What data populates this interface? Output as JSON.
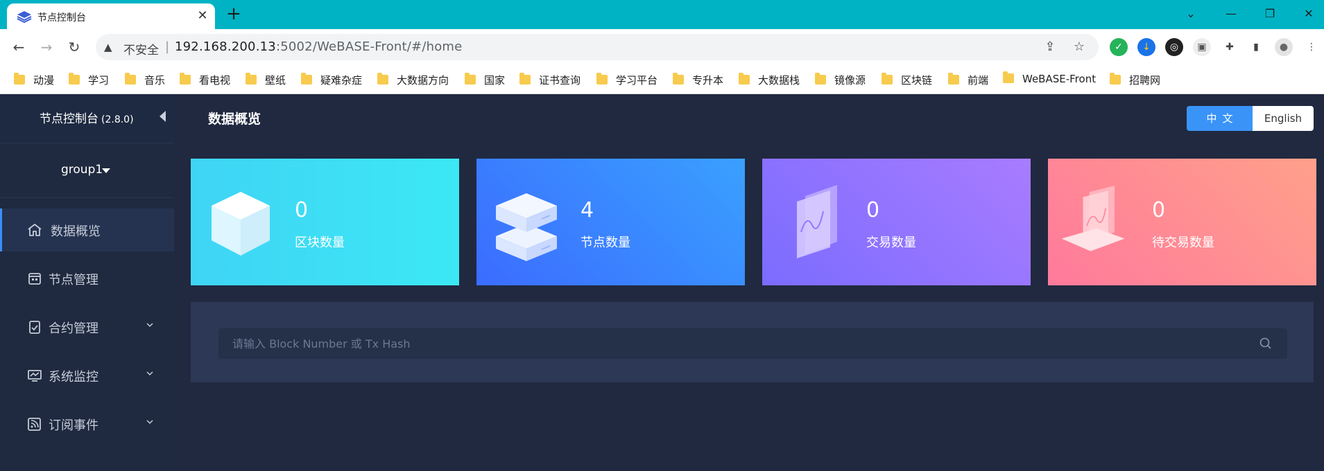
{
  "browser": {
    "tab_title": "节点控制台",
    "address": {
      "security_label": "不安全",
      "host": "192.168.200.13",
      "rest": ":5002/WeBASE-Front/#/home"
    },
    "bookmarks": [
      "动漫",
      "学习",
      "音乐",
      "看电视",
      "壁纸",
      "疑难杂症",
      "大数据方向",
      "国家",
      "证书查询",
      "学习平台",
      "专升本",
      "大数据栈",
      "镜像源",
      "区块链",
      "前端",
      "WeBASE-Front",
      "招聘网"
    ]
  },
  "sidebar": {
    "title": "节点控制台",
    "version": "(2.8.0)",
    "group": "group1",
    "items": [
      {
        "label": "数据概览",
        "active": true
      },
      {
        "label": "节点管理"
      },
      {
        "label": "合约管理"
      },
      {
        "label": "系统监控"
      },
      {
        "label": "订阅事件"
      }
    ]
  },
  "main": {
    "title": "数据概览",
    "lang": {
      "zh": "中文",
      "en": "English"
    },
    "cards": [
      {
        "value": "0",
        "label": "区块数量"
      },
      {
        "value": "4",
        "label": "节点数量"
      },
      {
        "value": "0",
        "label": "交易数量"
      },
      {
        "value": "0",
        "label": "待交易数量"
      }
    ],
    "search": {
      "placeholder": "请输入 Block Number 或 Tx Hash"
    }
  },
  "colors": {
    "tabbar": "#00b3c4",
    "sidebar": "#1f2a40",
    "content": "#202940",
    "accent": "#3a94f8",
    "card_block": [
      "#3fd4f5",
      "#3ce8f4"
    ],
    "card_node": [
      "#3b6cff",
      "#3aa0ff"
    ],
    "card_tx": [
      "#7b6cff",
      "#a87cff"
    ],
    "card_pending": [
      "#ff7a9c",
      "#ffa08a"
    ]
  }
}
